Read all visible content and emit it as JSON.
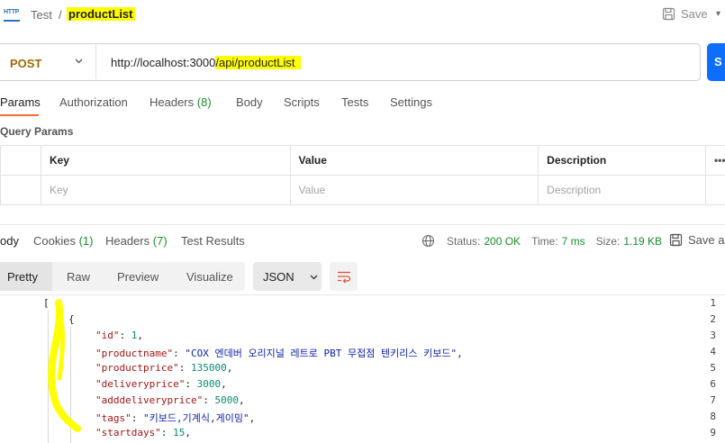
{
  "header": {
    "icon_text": "HTTP",
    "collection": "Test",
    "separator": "/",
    "request_name": "productList",
    "save_label": "Save"
  },
  "request": {
    "method": "POST",
    "url_base": "http://localhost:3000",
    "url_path": "/api/productList",
    "send_label": "S"
  },
  "request_tabs": [
    {
      "label": "Params"
    },
    {
      "label": "Authorization"
    },
    {
      "label": "Headers",
      "count": "(8)"
    },
    {
      "label": "Body"
    },
    {
      "label": "Scripts"
    },
    {
      "label": "Tests"
    },
    {
      "label": "Settings"
    }
  ],
  "query_params": {
    "title": "Query Params",
    "columns": [
      "Key",
      "Value",
      "Description"
    ],
    "more": "•••",
    "placeholders": [
      "Key",
      "Value",
      "Description"
    ]
  },
  "response_tabs": [
    {
      "label": "ody"
    },
    {
      "label": "Cookies",
      "count": "(1)"
    },
    {
      "label": "Headers",
      "count": "(7)"
    },
    {
      "label": "Test Results"
    }
  ],
  "response_status": {
    "status_label": "Status:",
    "status_value": "200 OK",
    "time_label": "Time:",
    "time_value": "7 ms",
    "size_label": "Size:",
    "size_value": "1.19 KB",
    "save_as_label": "Save as"
  },
  "view_modes": [
    "Pretty",
    "Raw",
    "Preview",
    "Visualize"
  ],
  "format": "JSON",
  "code_lines": [
    {
      "num": "1",
      "text": "["
    },
    {
      "num": "2",
      "text": "{"
    },
    {
      "num": "3",
      "key": "\"id\"",
      "value": "1",
      "vtype": "n"
    },
    {
      "num": "4",
      "key": "\"productname\"",
      "value": "\"COX 엔데버 오리지널 레트로 PBT 무접점 텐키리스 키보드\"",
      "vtype": "s"
    },
    {
      "num": "5",
      "key": "\"productprice\"",
      "value": "135000",
      "vtype": "n"
    },
    {
      "num": "6",
      "key": "\"deliveryprice\"",
      "value": "3000",
      "vtype": "n"
    },
    {
      "num": "7",
      "key": "\"adddeliveryprice\"",
      "value": "5000",
      "vtype": "n"
    },
    {
      "num": "8",
      "key": "\"tags\"",
      "value": "\"키보드,기계식,게이밍\"",
      "vtype": "s"
    },
    {
      "num": "9",
      "key": "\"startdays\"",
      "value": "15",
      "vtype": "n"
    }
  ],
  "colors": {
    "accent": "#f26b3a",
    "send": "#0d6efd",
    "highlight": "#ffff00",
    "method": "#9a6b00",
    "status_ok": "#168e2a"
  }
}
